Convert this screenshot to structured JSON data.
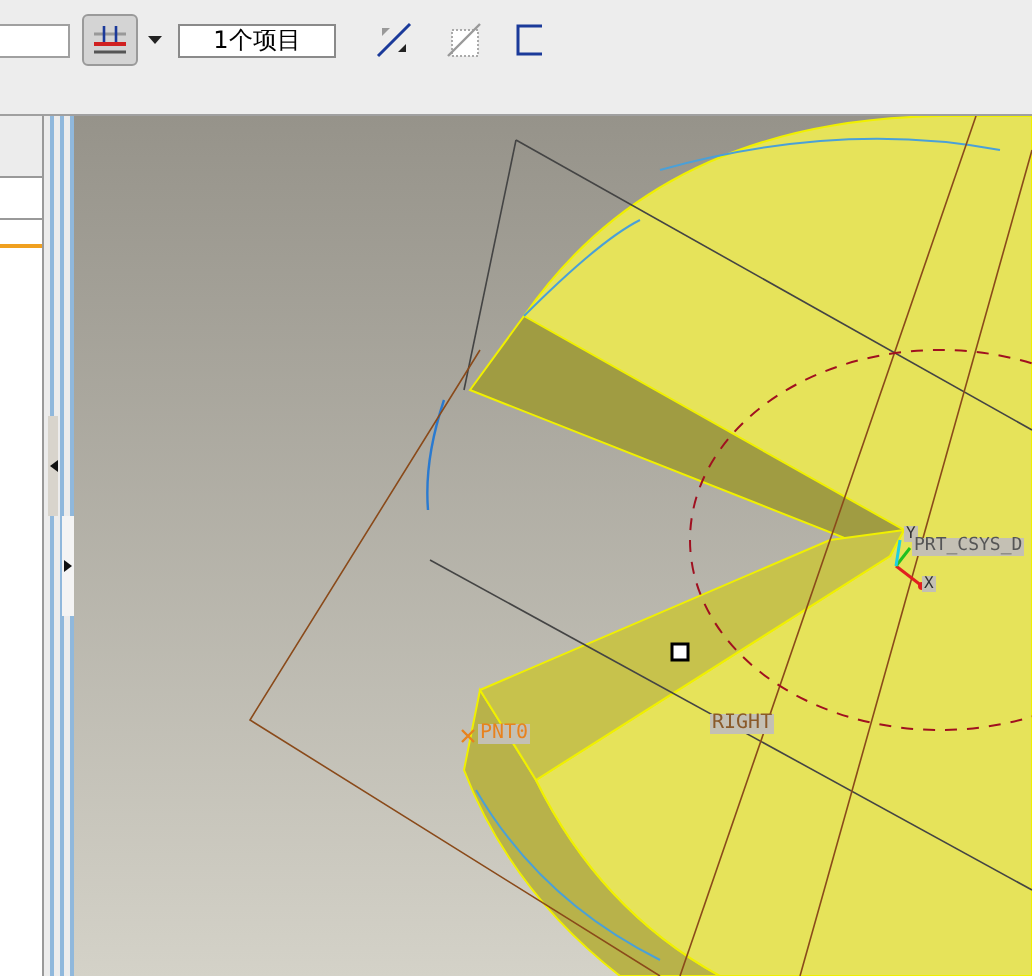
{
  "toolbar": {
    "filter_button": {
      "selected": true
    },
    "selection_count": "1个项目"
  },
  "viewport": {
    "labels": [
      {
        "text": "Y",
        "color": "#333333"
      },
      {
        "text": "PRT_CSYS_D",
        "color": "#555555"
      },
      {
        "text": "X",
        "color": "#333333"
      },
      {
        "text": "PNT0",
        "color": "#e8821e"
      },
      {
        "text": "RIGHT",
        "color": "#8a5a2a"
      }
    ]
  }
}
